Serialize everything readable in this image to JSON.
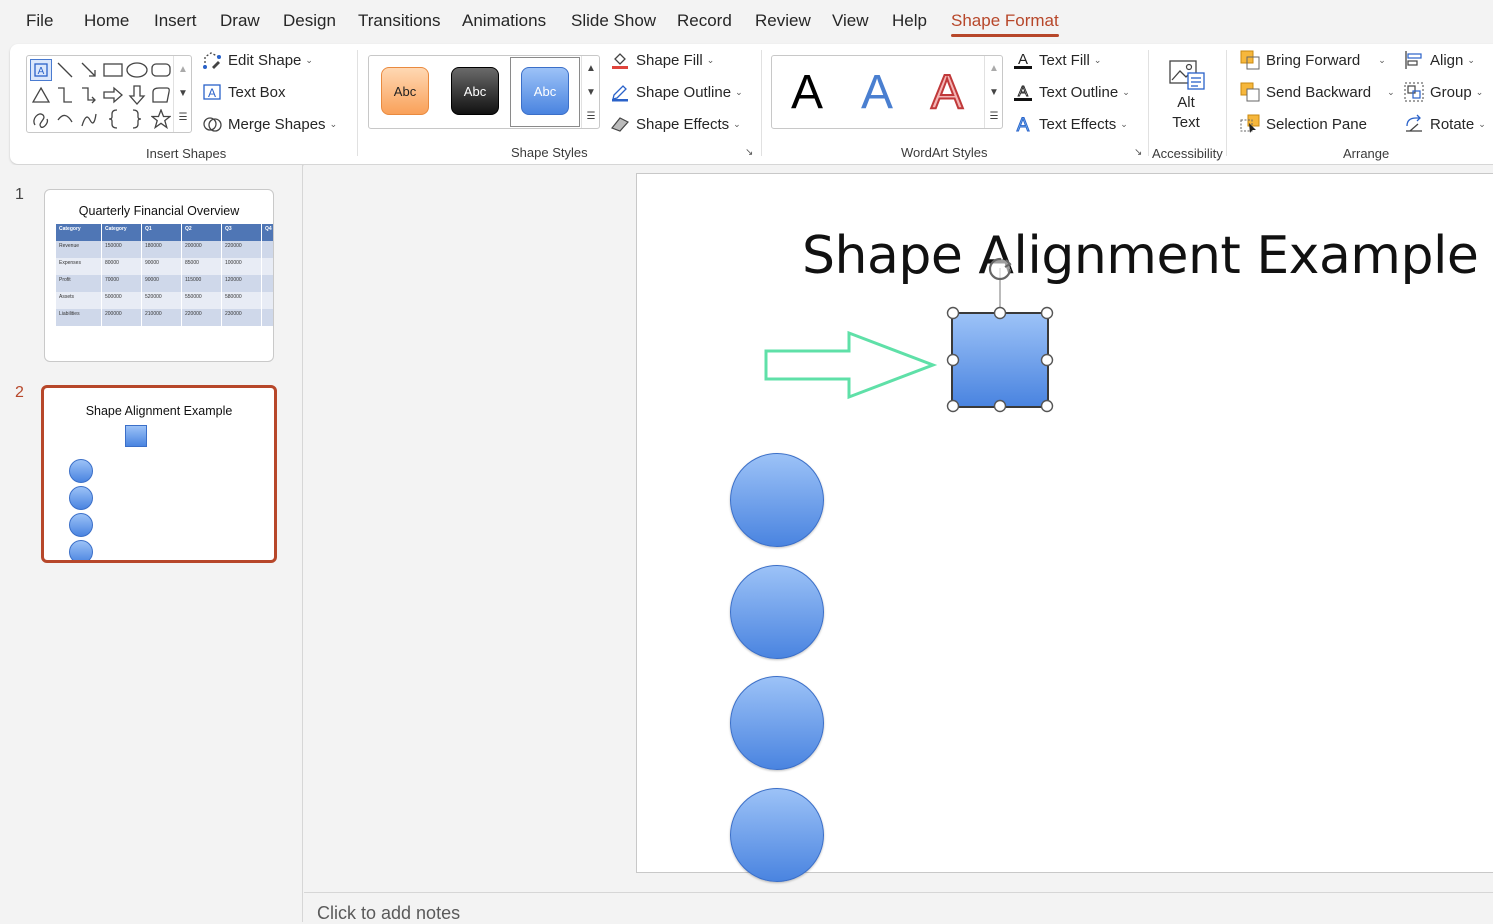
{
  "menu": {
    "tabs": [
      "File",
      "Home",
      "Insert",
      "Draw",
      "Design",
      "Transitions",
      "Animations",
      "Slide Show",
      "Record",
      "Review",
      "View",
      "Help",
      "Shape Format"
    ],
    "active": "Shape Format"
  },
  "ribbon": {
    "insert_shapes": {
      "label": "Insert Shapes",
      "edit_shape": "Edit Shape",
      "text_box": "Text Box",
      "merge_shapes": "Merge Shapes"
    },
    "shape_styles": {
      "label": "Shape Styles",
      "swatch_text": "Abc",
      "shape_fill": "Shape Fill",
      "shape_outline": "Shape Outline",
      "shape_effects": "Shape Effects"
    },
    "wordart_styles": {
      "label": "WordArt Styles",
      "sample_letter": "A",
      "text_fill": "Text Fill",
      "text_outline": "Text Outline",
      "text_effects": "Text Effects"
    },
    "accessibility": {
      "label": "Accessibility",
      "alt_text_line1": "Alt",
      "alt_text_line2": "Text"
    },
    "arrange": {
      "label": "Arrange",
      "bring_forward": "Bring Forward",
      "send_backward": "Send Backward",
      "selection_pane": "Selection Pane",
      "align": "Align",
      "group": "Group",
      "rotate": "Rotate"
    }
  },
  "thumbnails": [
    {
      "number": "1",
      "title": "Quarterly Financial Overview",
      "table_header": [
        "Category",
        "Category",
        "Q1",
        "Q2",
        "Q3",
        "Q4"
      ],
      "table_rows": [
        [
          "Revenue",
          "150000",
          "180000",
          "200000",
          "220000"
        ],
        [
          "Expenses",
          "80000",
          "90000",
          "85000",
          "100000"
        ],
        [
          "Profit",
          "70000",
          "90000",
          "115000",
          "120000"
        ],
        [
          "Assets",
          "500000",
          "520000",
          "550000",
          "580000"
        ],
        [
          "Liabilities",
          "200000",
          "210000",
          "220000",
          "230000"
        ]
      ]
    },
    {
      "number": "2",
      "title": "Shape Alignment Example"
    }
  ],
  "slide": {
    "title": "Shape Alignment Example"
  },
  "notes": {
    "placeholder": "Click to add notes"
  },
  "colors": {
    "accent": "#b7472a",
    "shape_blue": "#6e9be8",
    "arrow_green": "#5fe0a8"
  }
}
